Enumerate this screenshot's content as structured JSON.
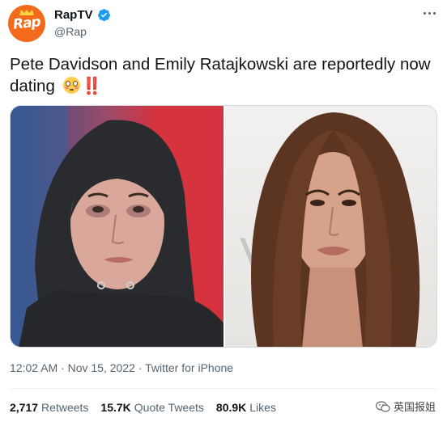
{
  "account": {
    "display_name": "RapTV",
    "handle": "@Rap",
    "avatar_text": "Rap",
    "avatar_color": "#f26b1d",
    "verified": true
  },
  "tweet": {
    "text": "Pete Davidson and Emily Ratajkowski are reportedly now dating",
    "emoji_flushed": "flushed-face",
    "emoji_bangs": "‼️",
    "time": "12:02 AM",
    "date": "Nov 15, 2022",
    "source": "Twitter for iPhone",
    "separator": "·"
  },
  "stats": {
    "retweets_count": "2,717",
    "retweets_label": "Retweets",
    "quotes_count": "15.7K",
    "quotes_label": "Quote Tweets",
    "likes_count": "80.9K",
    "likes_label": "Likes"
  },
  "watermark": {
    "text": "英国报姐",
    "icon": "wechat-icon"
  },
  "colors": {
    "accent": "#1d9bf0",
    "secondary_text": "#536471",
    "primary_text": "#0f1419"
  }
}
